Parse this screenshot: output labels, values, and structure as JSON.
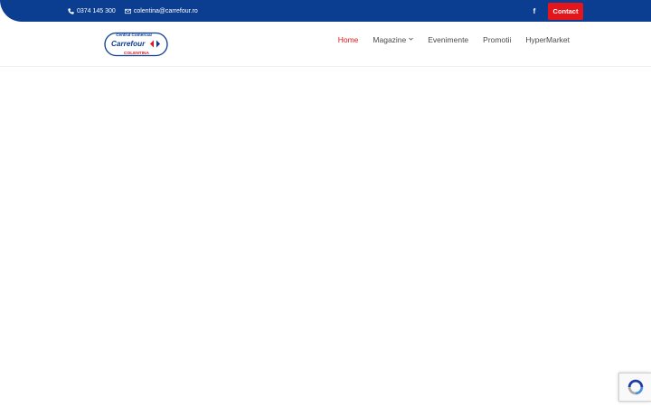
{
  "topbar": {
    "phone": "0374 145 300",
    "email": "colentina@carrefour.ro",
    "facebook_label": "f",
    "contact_label": "Contact",
    "colors": {
      "bar": "#0b3d91",
      "contact_button": "#e3161b"
    }
  },
  "logo": {
    "line1": "Centrul Comercial",
    "line2": "Carrefour",
    "line3": "COLENTINA"
  },
  "nav": {
    "items": [
      {
        "label": "Home",
        "active": true
      },
      {
        "label": "Magazine",
        "dropdown": true
      },
      {
        "label": "Evenimente"
      },
      {
        "label": "Promotii"
      },
      {
        "label": "HyperMarket"
      }
    ],
    "active_color": "#e3161b"
  },
  "icons": {
    "phone": "phone-icon",
    "email": "envelope-icon",
    "facebook": "facebook-icon",
    "dropdown": "chevron-down-icon",
    "recaptcha": "recaptcha-icon"
  }
}
